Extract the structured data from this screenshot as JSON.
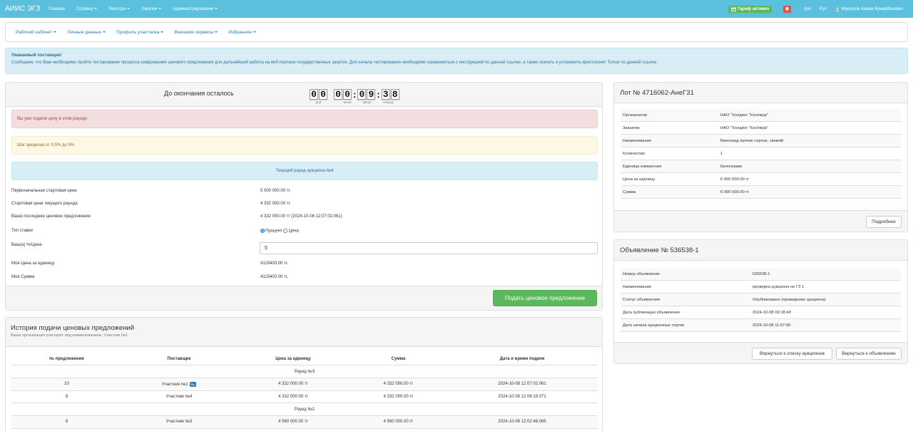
{
  "app": {
    "brand": "АИИС ЭГЗ"
  },
  "topnav": {
    "menu": [
      {
        "label": "Главная",
        "dropdown": false
      },
      {
        "label": "Справка",
        "dropdown": true
      },
      {
        "label": "Реестры",
        "dropdown": true
      },
      {
        "label": "Закупки",
        "dropdown": true
      },
      {
        "label": "Администрирование",
        "dropdown": true
      }
    ],
    "tariff": "Тариф активен",
    "lang_kz": "Қаз",
    "lang_ru": "Рус",
    "user": "Мукушов Арман Кумарбекович"
  },
  "subnav": {
    "items": [
      "Рабочий кабинет",
      "Личные данные",
      "Профиль участника",
      "Внешние сервисы",
      "Избранное"
    ]
  },
  "notice": {
    "title": "Уважаемый поставщик!",
    "body": "Сообщаем, что Вам необходимо пройти тестирование процесса шифрования ценового предложения для дальнейшей работы на веб-портале государственных закупок. Для начала тестирования необходимо ознакомиться с инструкцией по данной ссылке, а также скачать и установить криптосокет Tumar по данной ссылке."
  },
  "auction": {
    "countdown_label": "До окончания осталось",
    "timer": {
      "days": "00",
      "hours": "00",
      "minutes": "09",
      "seconds": "38"
    },
    "timer_labels": {
      "days": "дни",
      "hours": "часов",
      "minutes": "минут",
      "seconds": "секунд"
    },
    "alert_submitted": "Вы уже подали цену в этом раунде",
    "alert_step": "Шаг аукциона от 0.5% до 5%",
    "current_round": "Текущий раунд аукциона №4",
    "fields": {
      "initial_price_label": "Первоначальная стартовая цена",
      "initial_price": "5 000 000.00 тг.",
      "round_start_label": "Стартовая цена текущего раунда",
      "round_start": "4 332 000.00 тг.",
      "last_offer_label": "Ваше последнее ценовое предложение",
      "last_offer": "4 332 000.00 тг (2024-10-08 12:07:02.061)",
      "bid_type_label": "Тип ставки",
      "bid_type_percent": "Процент",
      "bid_type_price": "Цена",
      "bid_value_label": "Ваш(а) %/Цена",
      "bid_value": "5",
      "my_unit_price_label": "Моя Цена за единицу",
      "my_unit_price": "4115400.00 тг.",
      "my_sum_label": "Моя Сумма",
      "my_sum": "4115400.00 тг."
    },
    "submit_label": "Подать ценовое предложение"
  },
  "history": {
    "title": "История подачи ценовых предложений",
    "subtitle": "Ваша организация участвует под наименованием: Участник №1",
    "columns": [
      "№ предложения",
      "Поставщик",
      "Цена за единицу",
      "Сумма",
      "Дата и время подачи"
    ],
    "round3": "Раунд №3",
    "round2": "Раунд №2",
    "rows": [
      {
        "num": "10",
        "supplier": "Участник №1",
        "you": "Вы",
        "price": "4 332 000.00 тг",
        "sum": "4 332 000.00 тг",
        "date": "2024-10-08 12:07:02.061"
      },
      {
        "num": "9",
        "supplier": "Участник №4",
        "price": "4 332 000.00 тг",
        "sum": "4 332 000.00 тг",
        "date": "2024-10-08 12:06:19.071"
      },
      {
        "num": "8",
        "supplier": "Участник №3",
        "price": "4 560 000.00 тг",
        "sum": "4 560 000.00 тг",
        "date": "2024-10-08 12:02:46.065"
      }
    ]
  },
  "lot": {
    "title": "Лот № 4716062-АнеГ31",
    "rows": [
      {
        "k": "Организатор",
        "v": "НАО \"Холдинг \"Кәсіпқор\""
      },
      {
        "k": "Заказчик",
        "v": "НАО \"Холдинг \"Кәсіпқор\""
      },
      {
        "k": "Наименование",
        "v": "Виноград прочих сортов, свежий"
      },
      {
        "k": "Количество",
        "v": "1"
      },
      {
        "k": "Единица измерения",
        "v": "Килограмм"
      },
      {
        "k": "Цена за единицу",
        "v": "6 000 000.00 тг"
      },
      {
        "k": "Сумма",
        "v": "6 000 000.00 тг"
      }
    ],
    "more_label": "Подробнее"
  },
  "announcement": {
    "title": "Объявление № 536538-1",
    "rows": [
      {
        "k": "Номер объявления",
        "v": "536538-1"
      },
      {
        "k": "Наименование",
        "v": "проверка аукциона не ГЗ 1"
      },
      {
        "k": "Статус объявления",
        "v": "Опубликовано (проведение аукциона)"
      },
      {
        "k": "Дата публикации объявления",
        "v": "2024-10-08 09:18:40"
      },
      {
        "k": "Дата начала аукционных торгов",
        "v": "2024-10-08 11:57:00"
      }
    ],
    "back_list_label": "Вернуться к списку аукционов",
    "back_ann_label": "Вернуться к объявлению"
  }
}
